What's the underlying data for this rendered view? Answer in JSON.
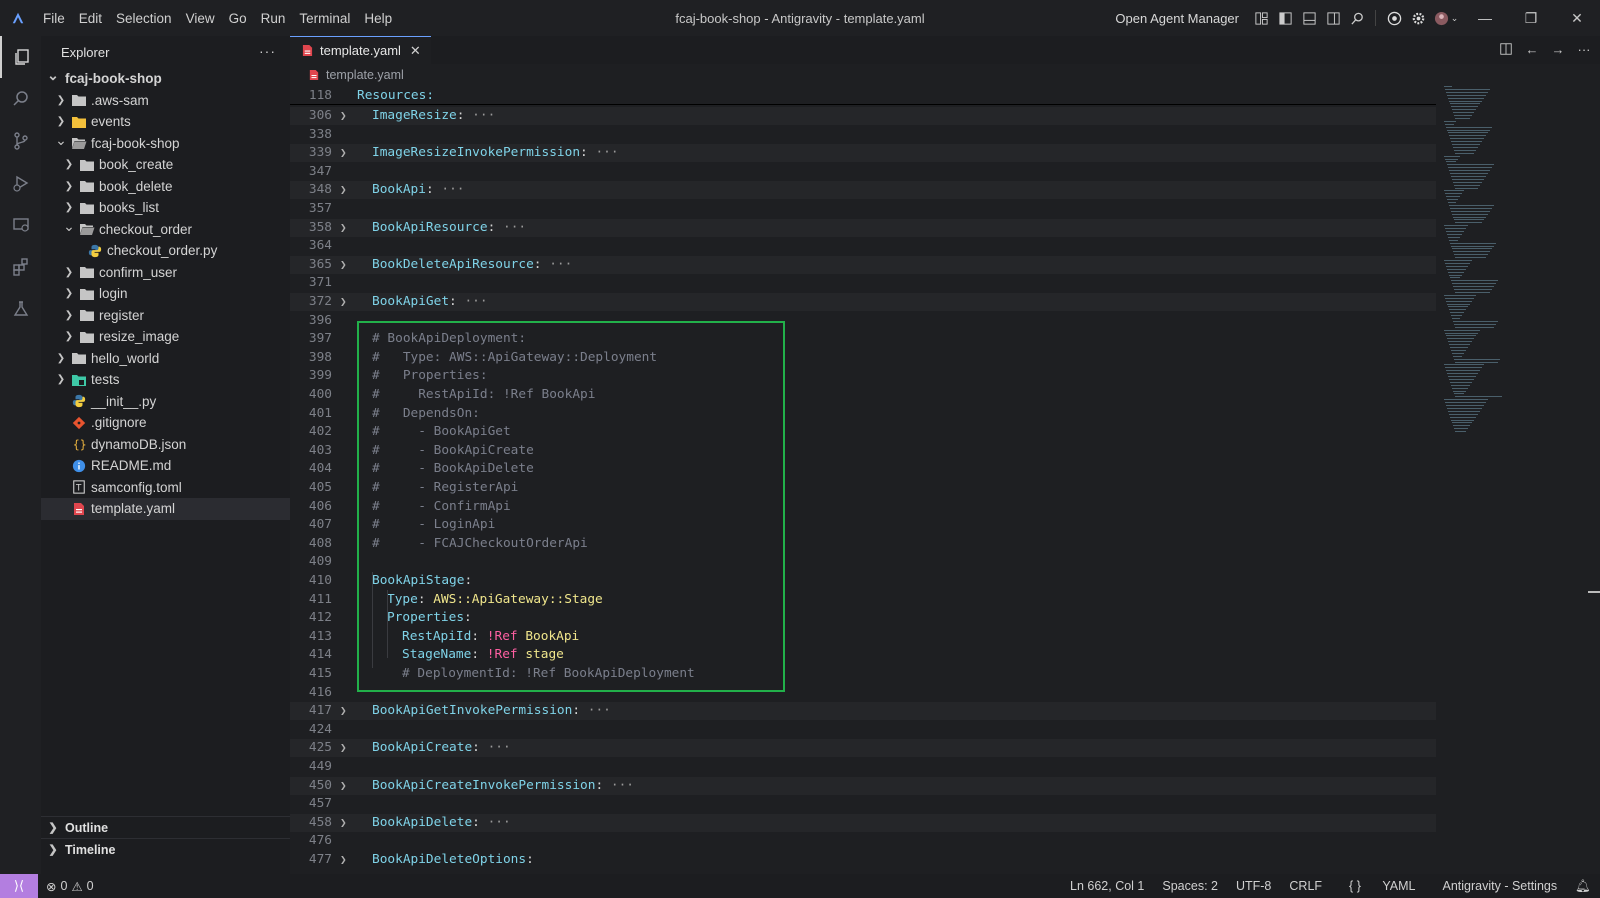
{
  "window": {
    "title": "fcaj-book-shop - Antigravity - template.yaml",
    "menu": [
      "File",
      "Edit",
      "Selection",
      "View",
      "Go",
      "Run",
      "Terminal",
      "Help"
    ],
    "agent_manager_label": "Open Agent Manager"
  },
  "sidebar": {
    "title": "Explorer",
    "more": "···",
    "tree": [
      {
        "label": "fcaj-book-shop",
        "depth": 0,
        "chevron": "down",
        "icon": "none"
      },
      {
        "label": ".aws-sam",
        "depth": 1,
        "chevron": "right",
        "icon": "folder"
      },
      {
        "label": "events",
        "depth": 1,
        "chevron": "right",
        "icon": "folder-yellow"
      },
      {
        "label": "fcaj-book-shop",
        "depth": 1,
        "chevron": "down",
        "icon": "folder-open"
      },
      {
        "label": "book_create",
        "depth": 2,
        "chevron": "right",
        "icon": "folder"
      },
      {
        "label": "book_delete",
        "depth": 2,
        "chevron": "right",
        "icon": "folder"
      },
      {
        "label": "books_list",
        "depth": 2,
        "chevron": "right",
        "icon": "folder"
      },
      {
        "label": "checkout_order",
        "depth": 2,
        "chevron": "down",
        "icon": "folder-open"
      },
      {
        "label": "checkout_order.py",
        "depth": 3,
        "chevron": "",
        "icon": "python"
      },
      {
        "label": "confirm_user",
        "depth": 2,
        "chevron": "right",
        "icon": "folder"
      },
      {
        "label": "login",
        "depth": 2,
        "chevron": "right",
        "icon": "folder"
      },
      {
        "label": "register",
        "depth": 2,
        "chevron": "right",
        "icon": "folder"
      },
      {
        "label": "resize_image",
        "depth": 2,
        "chevron": "right",
        "icon": "folder"
      },
      {
        "label": "hello_world",
        "depth": 1,
        "chevron": "right",
        "icon": "folder"
      },
      {
        "label": "tests",
        "depth": 1,
        "chevron": "right",
        "icon": "folder-test"
      },
      {
        "label": "__init__.py",
        "depth": 1,
        "chevron": "",
        "icon": "python"
      },
      {
        "label": ".gitignore",
        "depth": 1,
        "chevron": "",
        "icon": "git"
      },
      {
        "label": "dynamoDB.json",
        "depth": 1,
        "chevron": "",
        "icon": "json"
      },
      {
        "label": "README.md",
        "depth": 1,
        "chevron": "",
        "icon": "info"
      },
      {
        "label": "samconfig.toml",
        "depth": 1,
        "chevron": "",
        "icon": "toml"
      },
      {
        "label": "template.yaml",
        "depth": 1,
        "chevron": "",
        "icon": "yaml",
        "selected": true
      }
    ],
    "outline_label": "Outline",
    "timeline_label": "Timeline"
  },
  "editor": {
    "tab_label": "template.yaml",
    "breadcrumb": "template.yaml",
    "sticky": {
      "num": "118",
      "text": "Resources:"
    },
    "lines": [
      {
        "num": "306",
        "fold": true,
        "key": "ImageResize",
        "folded": true
      },
      {
        "num": "338",
        "text": ""
      },
      {
        "num": "339",
        "fold": true,
        "key": "ImageResizeInvokePermission",
        "folded": true
      },
      {
        "num": "347",
        "text": ""
      },
      {
        "num": "348",
        "fold": true,
        "key": "BookApi",
        "folded": true
      },
      {
        "num": "357",
        "text": ""
      },
      {
        "num": "358",
        "fold": true,
        "key": "BookApiResource",
        "folded": true
      },
      {
        "num": "364",
        "text": ""
      },
      {
        "num": "365",
        "fold": true,
        "key": "BookDeleteApiResource",
        "folded": true
      },
      {
        "num": "371",
        "text": ""
      },
      {
        "num": "372",
        "fold": true,
        "key": "BookApiGet",
        "folded": true
      },
      {
        "num": "396",
        "text": ""
      },
      {
        "num": "397",
        "comment": "# BookApiDeployment:"
      },
      {
        "num": "398",
        "comment": "#   Type: AWS::ApiGateway::Deployment"
      },
      {
        "num": "399",
        "comment": "#   Properties:"
      },
      {
        "num": "400",
        "comment": "#     RestApiId: !Ref BookApi"
      },
      {
        "num": "401",
        "comment": "#   DependsOn:"
      },
      {
        "num": "402",
        "comment": "#     - BookApiGet"
      },
      {
        "num": "403",
        "comment": "#     - BookApiCreate"
      },
      {
        "num": "404",
        "comment": "#     - BookApiDelete"
      },
      {
        "num": "405",
        "comment": "#     - RegisterApi"
      },
      {
        "num": "406",
        "comment": "#     - ConfirmApi"
      },
      {
        "num": "407",
        "comment": "#     - LoginApi"
      },
      {
        "num": "408",
        "comment": "#     - FCAJCheckoutOrderApi"
      },
      {
        "num": "409",
        "text": ""
      },
      {
        "num": "410",
        "key": "BookApiStage",
        "indent": 0
      },
      {
        "num": "411",
        "key": "Type",
        "indent": 1,
        "value": "AWS::ApiGateway::Stage"
      },
      {
        "num": "412",
        "key": "Properties",
        "indent": 1
      },
      {
        "num": "413",
        "key": "RestApiId",
        "indent": 2,
        "tag": "!Ref",
        "value": "BookApi"
      },
      {
        "num": "414",
        "key": "StageName",
        "indent": 2,
        "tag": "!Ref",
        "value": "stage"
      },
      {
        "num": "415",
        "comment": "# DeploymentId: !Ref BookApiDeployment",
        "indent": 2
      },
      {
        "num": "416",
        "text": ""
      },
      {
        "num": "417",
        "fold": true,
        "key": "BookApiGetInvokePermission",
        "folded": true
      },
      {
        "num": "424",
        "text": ""
      },
      {
        "num": "425",
        "fold": true,
        "key": "BookApiCreate",
        "folded": true
      },
      {
        "num": "449",
        "text": ""
      },
      {
        "num": "450",
        "fold": true,
        "key": "BookApiCreateInvokePermission",
        "folded": true
      },
      {
        "num": "457",
        "text": ""
      },
      {
        "num": "458",
        "fold": true,
        "key": "BookApiDelete",
        "folded": true
      },
      {
        "num": "476",
        "text": ""
      },
      {
        "num": "477",
        "fold": true,
        "key": "BookApiDeleteOptions",
        "folded": false
      }
    ]
  },
  "statusbar": {
    "errors": "0",
    "warnings": "0",
    "position": "Ln 662, Col 1",
    "spaces": "Spaces: 2",
    "encoding": "UTF-8",
    "eol": "CRLF",
    "language": "YAML",
    "settings": "Antigravity - Settings"
  },
  "colors": {
    "accent": "#6aa0ff",
    "highlight_box": "#22b04a",
    "remote": "#b37ee0",
    "yaml_key": "#7fd3e8",
    "yaml_value": "#f0e68c",
    "yaml_tag": "#ff5fa2"
  }
}
